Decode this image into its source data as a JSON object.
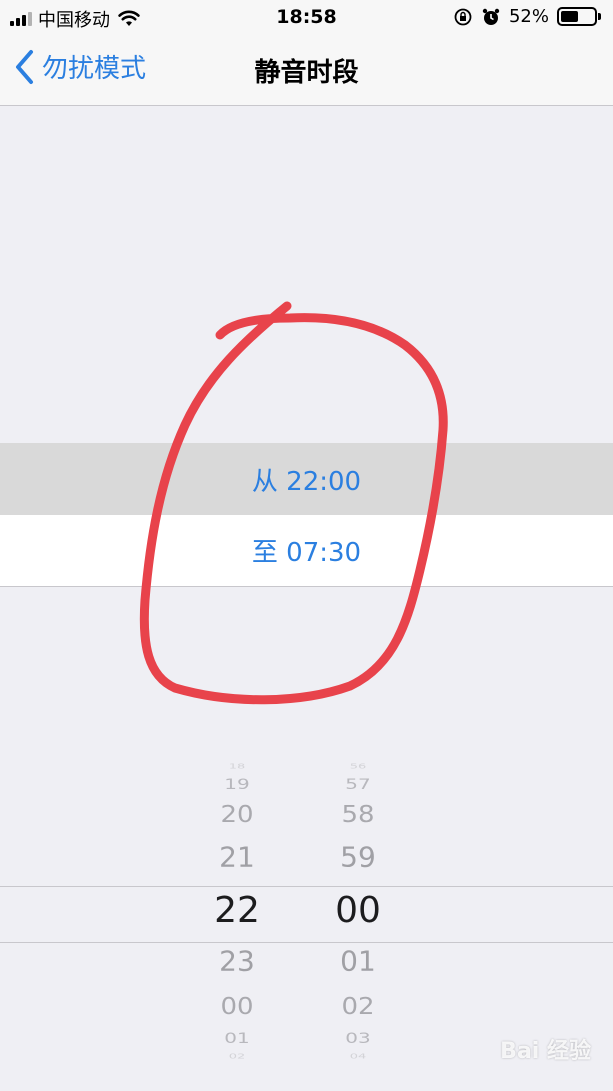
{
  "status_bar": {
    "carrier": "中国移动",
    "time": "18:58",
    "battery_percent": "52%",
    "battery_level": 0.52,
    "icons": [
      "signal-icon",
      "wifi-icon",
      "orientation-lock-icon",
      "alarm-icon",
      "battery-icon"
    ]
  },
  "nav": {
    "back_label": "勿扰模式",
    "title": "静音时段"
  },
  "rows": {
    "from_label": "从 22:00",
    "to_label": "至 07:30"
  },
  "picker": {
    "hours": [
      "18",
      "19",
      "20",
      "21",
      "22",
      "23",
      "00",
      "01",
      "02"
    ],
    "minutes": [
      "56",
      "57",
      "58",
      "59",
      "00",
      "01",
      "02",
      "03",
      "04"
    ],
    "selected_hour": "22",
    "selected_minute": "00"
  },
  "colors": {
    "accent": "#2b7fe0",
    "annotation": "#e8434b",
    "background": "#efeff4"
  },
  "watermark": "Bai 经验"
}
